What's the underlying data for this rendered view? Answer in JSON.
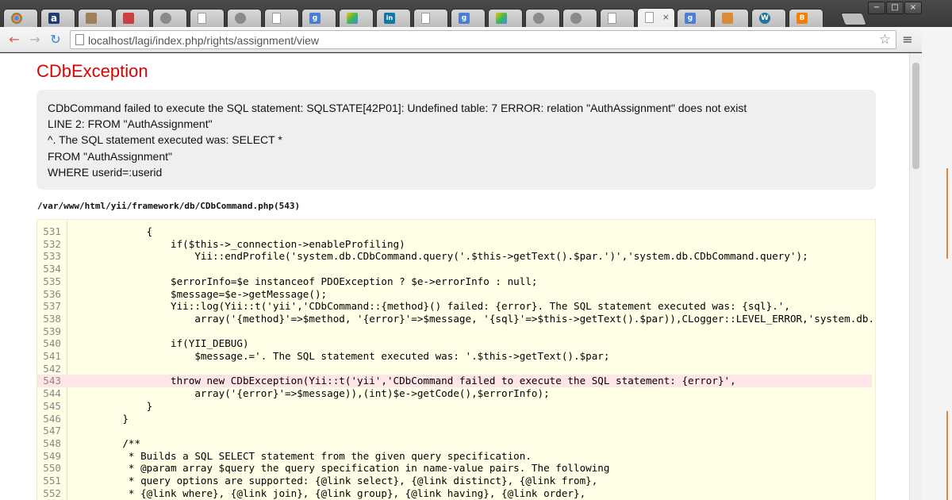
{
  "browser": {
    "tabs": [
      {
        "icon": "chrome-icon",
        "glyph": ""
      },
      {
        "icon": "amazon-icon",
        "glyph": "a"
      },
      {
        "icon": "photo-icon",
        "glyph": ""
      },
      {
        "icon": "app-icon",
        "glyph": ""
      },
      {
        "icon": "globe-icon",
        "glyph": ""
      },
      {
        "icon": "document-icon",
        "glyph": ""
      },
      {
        "icon": "globe-icon",
        "glyph": ""
      },
      {
        "icon": "document-icon",
        "glyph": ""
      },
      {
        "icon": "google-icon",
        "glyph": "g"
      },
      {
        "icon": "drive-icon",
        "glyph": ""
      },
      {
        "icon": "linkedin-icon",
        "glyph": "in"
      },
      {
        "icon": "document-icon",
        "glyph": ""
      },
      {
        "icon": "google-icon",
        "glyph": "g"
      },
      {
        "icon": "drive-icon",
        "glyph": ""
      },
      {
        "icon": "globe-icon",
        "glyph": ""
      },
      {
        "icon": "globe-icon",
        "glyph": ""
      },
      {
        "icon": "document-icon",
        "glyph": ""
      },
      {
        "icon": "document-icon",
        "glyph": "",
        "active": true,
        "close": "×"
      },
      {
        "icon": "google-icon",
        "glyph": "g"
      },
      {
        "icon": "folder-icon",
        "glyph": ""
      },
      {
        "icon": "wordpress-icon",
        "glyph": "W"
      },
      {
        "icon": "blogger-icon",
        "glyph": "B"
      }
    ],
    "window_controls": {
      "minimize": "−",
      "maximize": "□",
      "close": "×"
    },
    "nav": {
      "back": "←",
      "forward": "→",
      "reload": "↻"
    },
    "url": "localhost/lagi/index.php/rights/assignment/view",
    "star": "☆",
    "menu": "≡"
  },
  "page": {
    "title": "CDbException",
    "message_lines": [
      "CDbCommand failed to execute the SQL statement: SQLSTATE[42P01]: Undefined table: 7 ERROR: relation \"AuthAssignment\" does not exist",
      "LINE 2: FROM \"AuthAssignment\"",
      "^. The SQL statement executed was: SELECT *",
      "FROM \"AuthAssignment\"",
      "WHERE userid=:userid"
    ],
    "file_path": "/var/www/html/yii/framework/db/CDbCommand.php(543)",
    "highlight_line": 543,
    "code_lines": [
      {
        "n": "531",
        "t": "        {"
      },
      {
        "n": "532",
        "t": "            if($this->_connection->enableProfiling)"
      },
      {
        "n": "533",
        "t": "                Yii::endProfile('system.db.CDbCommand.query('.$this->getText().$par.')','system.db.CDbCommand.query');"
      },
      {
        "n": "534",
        "t": ""
      },
      {
        "n": "535",
        "t": "            $errorInfo=$e instanceof PDOException ? $e->errorInfo : null;"
      },
      {
        "n": "536",
        "t": "            $message=$e->getMessage();"
      },
      {
        "n": "537",
        "t": "            Yii::log(Yii::t('yii','CDbCommand::{method}() failed: {error}. The SQL statement executed was: {sql}.',"
      },
      {
        "n": "538",
        "t": "                array('{method}'=>$method, '{error}'=>$message, '{sql}'=>$this->getText().$par)),CLogger::LEVEL_ERROR,'system.db.CDbC("
      },
      {
        "n": "539",
        "t": ""
      },
      {
        "n": "540",
        "t": "            if(YII_DEBUG)"
      },
      {
        "n": "541",
        "t": "                $message.='. The SQL statement executed was: '.$this->getText().$par;"
      },
      {
        "n": "542",
        "t": ""
      },
      {
        "n": "543",
        "t": "            throw new CDbException(Yii::t('yii','CDbCommand failed to execute the SQL statement: {error}',"
      },
      {
        "n": "544",
        "t": "                array('{error}'=>$message)),(int)$e->getCode(),$errorInfo);"
      },
      {
        "n": "545",
        "t": "        }"
      },
      {
        "n": "546",
        "t": "    }"
      },
      {
        "n": "547",
        "t": ""
      },
      {
        "n": "548",
        "t": "    /**"
      },
      {
        "n": "549",
        "t": "     * Builds a SQL SELECT statement from the given query specification."
      },
      {
        "n": "550",
        "t": "     * @param array $query the query specification in name-value pairs. The following"
      },
      {
        "n": "551",
        "t": "     * query options are supported: {@link select}, {@link distinct}, {@link from},"
      },
      {
        "n": "552",
        "t": "     * {@link where}, {@link join}, {@link group}, {@link having}, {@link order},"
      }
    ]
  }
}
